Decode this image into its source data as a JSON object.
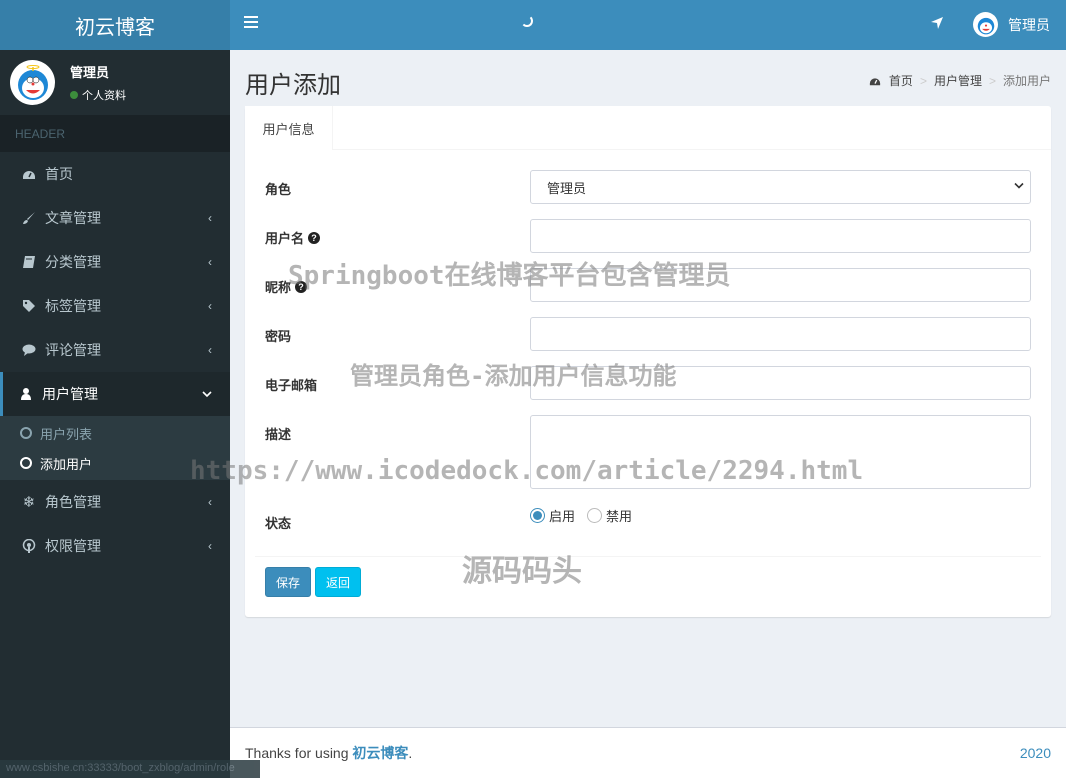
{
  "app": {
    "logo_text": "初云博客"
  },
  "sidebar": {
    "user": {
      "name": "管理员",
      "status": "个人资料",
      "status_color": "#3c8d3c"
    },
    "header": "HEADER",
    "items": [
      {
        "label": "首页",
        "icon": "dashboard-icon"
      },
      {
        "label": "文章管理",
        "icon": "paint-brush-icon",
        "chevron": "‹"
      },
      {
        "label": "分类管理",
        "icon": "book-icon",
        "chevron": "‹"
      },
      {
        "label": "标签管理",
        "icon": "tag-icon",
        "chevron": "‹"
      },
      {
        "label": "评论管理",
        "icon": "comment-icon",
        "chevron": "‹"
      },
      {
        "label": "用户管理",
        "icon": "user-icon",
        "chevron": "⌄",
        "active": true,
        "children": [
          {
            "label": "用户列表"
          },
          {
            "label": "添加用户",
            "active": true
          }
        ]
      },
      {
        "label": "角色管理",
        "icon": "snowflake-icon",
        "chevron": "‹"
      },
      {
        "label": "权限管理",
        "icon": "podcast-icon",
        "chevron": "‹"
      }
    ],
    "status_url": "www.csbishe.cn:33333/boot_zxblog/admin/role"
  },
  "navbar": {
    "user_name": "管理员"
  },
  "page": {
    "title": "用户添加",
    "breadcrumb": [
      "首页",
      "用户管理",
      "添加用户"
    ],
    "breadcrumb_sep": ">"
  },
  "form": {
    "tab": "用户信息",
    "fields": {
      "role": {
        "label": "角色",
        "value": "管理员"
      },
      "username": {
        "label": "用户名",
        "value": "",
        "help": "?"
      },
      "nickname": {
        "label": "昵称",
        "value": "",
        "help": "?"
      },
      "password": {
        "label": "密码",
        "value": ""
      },
      "email": {
        "label": "电子邮箱",
        "value": ""
      },
      "description": {
        "label": "描述",
        "value": ""
      },
      "status": {
        "label": "状态",
        "options": [
          "启用",
          "禁用"
        ],
        "selected": "启用"
      }
    },
    "buttons": {
      "save": "保存",
      "back": "返回"
    }
  },
  "watermarks": [
    "Springboot在线博客平台包含管理员",
    "管理员角色-添加用户信息功能",
    "https://www.icodedock.com/article/2294.html",
    "源码码头"
  ],
  "footer": {
    "prefix": "Thanks for using ",
    "link": "初云博客",
    "suffix": ".",
    "year": "2020"
  },
  "colors": {
    "primary": "#3c8dbc",
    "info": "#00c0ef",
    "sidebar_bg": "#222d32",
    "logo_bg": "#367fa9"
  }
}
